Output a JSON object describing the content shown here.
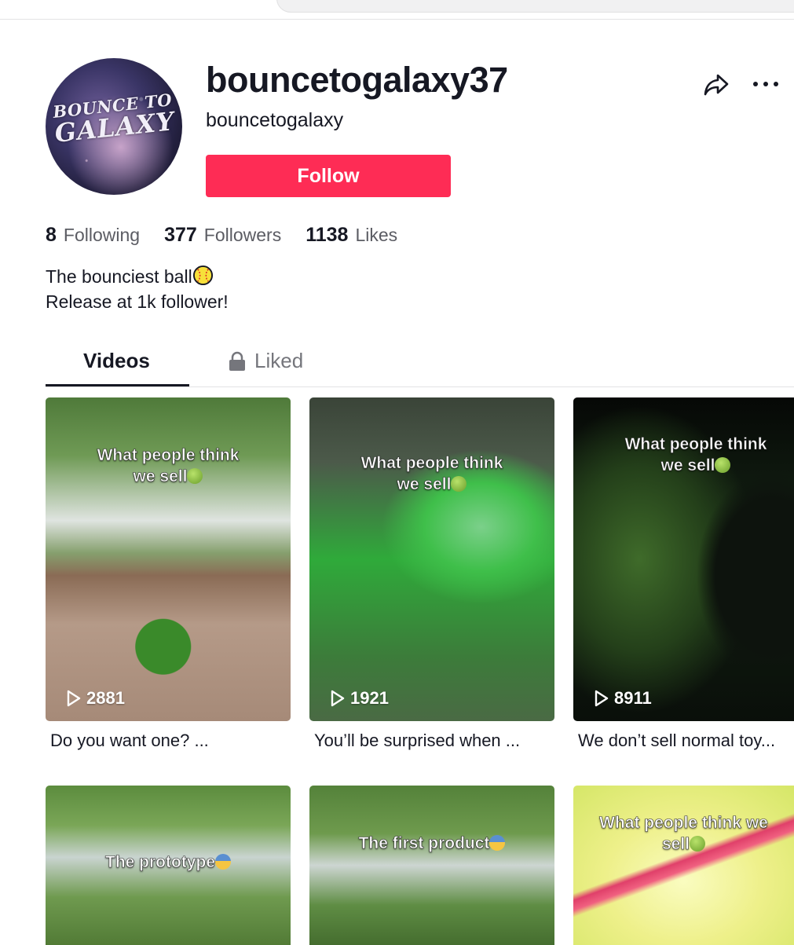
{
  "profile": {
    "avatar_text_line1": "BOUNCE TO",
    "avatar_text_line2": "GALAXY",
    "username": "bouncetogalaxy37",
    "nickname": "bouncetogalaxy",
    "follow_label": "Follow",
    "accent_color": "#fe2c55"
  },
  "stats": {
    "following_count": "8",
    "following_label": "Following",
    "followers_count": "377",
    "followers_label": "Followers",
    "likes_count": "1138",
    "likes_label": "Likes"
  },
  "bio": {
    "line1": "The bounciest ball",
    "line2": "Release at 1k follower!"
  },
  "tabs": {
    "videos": "Videos",
    "liked": "Liked"
  },
  "icons": {
    "share": "share-icon",
    "more": "more-icon",
    "lock": "lock-icon",
    "play": "play-icon"
  },
  "videos": [
    {
      "overlay_line1": "What people think",
      "overlay_line2": "we sell",
      "views": "2881",
      "caption": "Do you want one? ..."
    },
    {
      "overlay_line1": "What people think",
      "overlay_line2": "we sell",
      "views": "1921",
      "caption": "You’ll be surprised when ..."
    },
    {
      "overlay_line1": "What people think",
      "overlay_line2": "we sell",
      "views": "8911",
      "caption": "We don’t sell normal toy..."
    },
    {
      "overlay_line1": "The prototype"
    },
    {
      "overlay_line1": "The first product"
    },
    {
      "overlay_line1": "What people think we",
      "overlay_line2": "sell"
    }
  ]
}
